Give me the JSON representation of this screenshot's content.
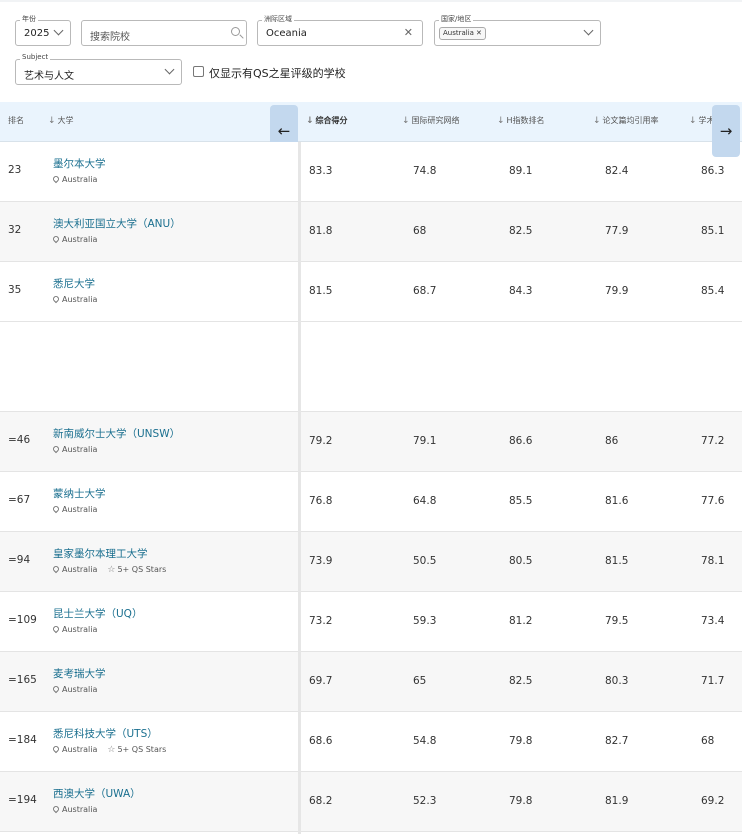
{
  "filters": {
    "year": {
      "label": "年份",
      "value": "2025"
    },
    "search": {
      "placeholder": "搜索院校"
    },
    "region": {
      "label": "洲际区域",
      "value": "Oceania"
    },
    "country": {
      "label": "国家/地区",
      "chip": "Australia"
    },
    "subject": {
      "label": "Subject",
      "value": "艺术与人文"
    },
    "qs_only_label": "仅显示有QS之星评级的学校"
  },
  "table": {
    "headers": {
      "rank": "排名",
      "university": "大学",
      "overall": "综合得分",
      "intl_network": "国际研究网络",
      "h_index": "H指数排名",
      "citations": "论文篇均引用率",
      "academic": "学术"
    },
    "rows": [
      {
        "rank": "23",
        "name": "墨尔本大学",
        "location": "Australia",
        "stars": "",
        "overall": "83.3",
        "intl": "74.8",
        "h": "89.1",
        "cit": "82.4",
        "acad": "86.3"
      },
      {
        "rank": "32",
        "name": "澳大利亚国立大学（ANU）",
        "location": "Australia",
        "stars": "",
        "overall": "81.8",
        "intl": "68",
        "h": "82.5",
        "cit": "77.9",
        "acad": "85.1"
      },
      {
        "rank": "35",
        "name": "悉尼大学",
        "location": "Australia",
        "stars": "",
        "overall": "81.5",
        "intl": "68.7",
        "h": "84.3",
        "cit": "79.9",
        "acad": "85.4"
      },
      {
        "rank": "=46",
        "name": "新南威尔士大学（UNSW）",
        "location": "Australia",
        "stars": "",
        "overall": "79.2",
        "intl": "79.1",
        "h": "86.6",
        "cit": "86",
        "acad": "77.2"
      },
      {
        "rank": "=67",
        "name": "蒙纳士大学",
        "location": "Australia",
        "stars": "",
        "overall": "76.8",
        "intl": "64.8",
        "h": "85.5",
        "cit": "81.6",
        "acad": "77.6"
      },
      {
        "rank": "=94",
        "name": "皇家墨尔本理工大学",
        "location": "Australia",
        "stars": "5+ QS Stars",
        "overall": "73.9",
        "intl": "50.5",
        "h": "80.5",
        "cit": "81.5",
        "acad": "78.1"
      },
      {
        "rank": "=109",
        "name": "昆士兰大学（UQ）",
        "location": "Australia",
        "stars": "",
        "overall": "73.2",
        "intl": "59.3",
        "h": "81.2",
        "cit": "79.5",
        "acad": "73.4"
      },
      {
        "rank": "=165",
        "name": "麦考瑞大学",
        "location": "Australia",
        "stars": "",
        "overall": "69.7",
        "intl": "65",
        "h": "82.5",
        "cit": "80.3",
        "acad": "71.7"
      },
      {
        "rank": "=184",
        "name": "悉尼科技大学（UTS）",
        "location": "Australia",
        "stars": "5+ QS Stars",
        "overall": "68.6",
        "intl": "54.8",
        "h": "79.8",
        "cit": "82.7",
        "acad": "68"
      },
      {
        "rank": "=194",
        "name": "西澳大学（UWA）",
        "location": "Australia",
        "stars": "",
        "overall": "68.2",
        "intl": "52.3",
        "h": "79.8",
        "cit": "81.9",
        "acad": "69.2"
      }
    ]
  },
  "icons": {
    "prev": "arrow-left-icon",
    "next": "arrow-right-icon"
  }
}
